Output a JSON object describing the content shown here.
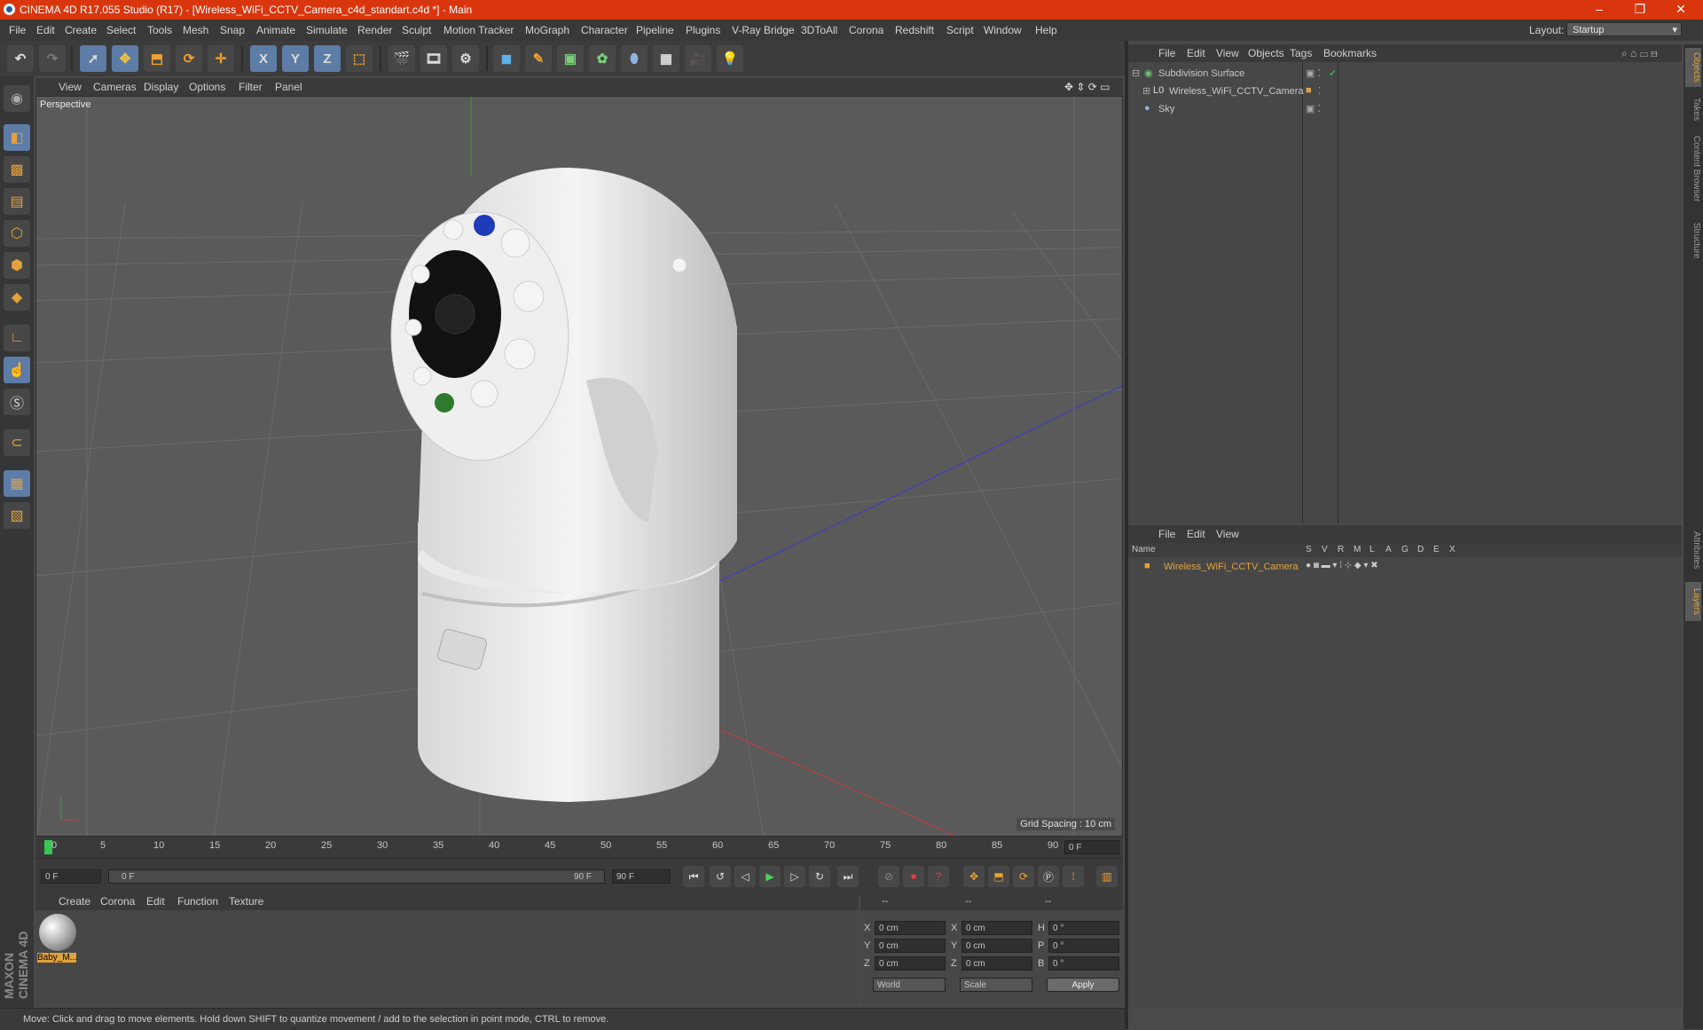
{
  "window": {
    "title": "CINEMA 4D R17.055 Studio (R17) - [Wireless_WiFi_CCTV_Camera_c4d_standart.c4d *] - Main",
    "controls": [
      "–",
      "❐",
      "✕"
    ]
  },
  "menubar": {
    "items": [
      "File",
      "Edit",
      "Create",
      "Select",
      "Tools",
      "Mesh",
      "Snap",
      "Animate",
      "Simulate",
      "Render",
      "Sculpt",
      "Motion Tracker",
      "MoGraph",
      "Character",
      "Pipeline",
      "Plugins",
      "V-Ray Bridge",
      "3DToAll",
      "Corona",
      "Redshift",
      "Script",
      "Window",
      "Help"
    ],
    "layout_label": "Layout:",
    "layout_value": "Startup"
  },
  "toolbar": {
    "axis_x": "X",
    "axis_y": "Y",
    "axis_z": "Z"
  },
  "viewport": {
    "menu": [
      "View",
      "Cameras",
      "Display",
      "Options",
      "Filter",
      "Panel"
    ],
    "label": "Perspective",
    "grid_spacing": "Grid Spacing : 10 cm"
  },
  "timeline": {
    "ticks": [
      "0",
      "5",
      "10",
      "15",
      "20",
      "25",
      "30",
      "35",
      "40",
      "45",
      "50",
      "55",
      "60",
      "65",
      "70",
      "75",
      "80",
      "85",
      "90"
    ],
    "current_frame": "0 F",
    "start_field": "0 F",
    "range_start": "0 F",
    "range_end": "90 F",
    "end_field": "90 F"
  },
  "material_manager": {
    "menu": [
      "Create",
      "Corona",
      "Edit",
      "Function",
      "Texture"
    ],
    "material_name": "Baby_M..."
  },
  "coordinates": {
    "headers": [
      "--",
      "--",
      "--"
    ],
    "rows": [
      {
        "a": "X",
        "a_val": "0 cm",
        "b": "X",
        "b_val": "0 cm",
        "c": "H",
        "c_val": "0 °"
      },
      {
        "a": "Y",
        "a_val": "0 cm",
        "b": "Y",
        "b_val": "0 cm",
        "c": "P",
        "c_val": "0 °"
      },
      {
        "a": "Z",
        "a_val": "0 cm",
        "b": "Z",
        "b_val": "0 cm",
        "c": "B",
        "c_val": "0 °"
      }
    ],
    "mode": "World",
    "scale": "Scale",
    "apply": "Apply"
  },
  "object_manager": {
    "menu": [
      "File",
      "Edit",
      "View",
      "Objects",
      "Tags",
      "Bookmarks"
    ],
    "objects": [
      {
        "name": "Subdivision Surface",
        "icon": "subdivision-icon",
        "color": "#6cc46c"
      },
      {
        "name": "Wireless_WiFi_CCTV_Camera",
        "icon": "null-object-icon",
        "color": "#c8c8c8"
      },
      {
        "name": "Sky",
        "icon": "sky-icon",
        "color": "#8fb3e0"
      }
    ]
  },
  "layer_manager": {
    "menu": [
      "File",
      "Edit",
      "View"
    ],
    "columns": [
      "Name",
      "S",
      "V",
      "R",
      "M",
      "L",
      "A",
      "G",
      "D",
      "E",
      "X"
    ],
    "layers": [
      {
        "name": "Wireless_WiFi_CCTV_Camera",
        "color": "#e2a23b"
      }
    ]
  },
  "side_tabs": [
    "Objects",
    "Takes",
    "Content Browser",
    "Structure",
    "Attributes",
    "Layers"
  ],
  "statusbar": {
    "text": "Move: Click and drag to move elements. Hold down SHIFT to quantize movement / add to the selection in point mode, CTRL to remove."
  },
  "branding": {
    "maxon": "MAXON CINEMA 4D"
  },
  "colors": {
    "accent": "#d9360e",
    "selection": "#5d7ca6",
    "layer_orange": "#e2a23b"
  }
}
